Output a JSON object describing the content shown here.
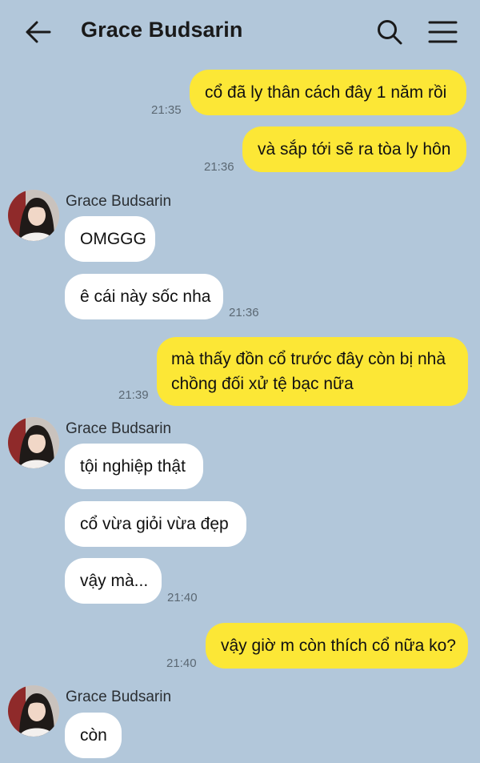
{
  "header": {
    "title": "Grace Budsarin",
    "back_icon": "arrow-left-icon",
    "search_icon": "search-icon",
    "menu_icon": "hamburger-menu-icon"
  },
  "colors": {
    "background": "#b2c7da",
    "outgoing_bubble": "#fce736",
    "incoming_bubble": "#ffffff"
  },
  "messages": [
    {
      "direction": "out",
      "text": "cổ đã ly thân cách đây 1 năm rồi",
      "time": "21:35"
    },
    {
      "direction": "out",
      "text": "và sắp tới sẽ ra tòa ly hôn",
      "time": "21:36"
    },
    {
      "direction": "in",
      "sender": "Grace Budsarin",
      "text": "OMGGG"
    },
    {
      "direction": "in",
      "text": "ê cái này sốc nha",
      "time": "21:36"
    },
    {
      "direction": "out",
      "text": "mà thấy đồn cổ trước đây còn bị nhà chồng đối xử tệ bạc nữa",
      "time": "21:39"
    },
    {
      "direction": "in",
      "sender": "Grace Budsarin",
      "text": "tội nghiệp thật"
    },
    {
      "direction": "in",
      "text": "cổ vừa giỏi vừa đẹp"
    },
    {
      "direction": "in",
      "text": "vậy mà...",
      "time": "21:40"
    },
    {
      "direction": "out",
      "text": "vậy giờ m còn thích cổ nữa ko?",
      "time": "21:40"
    },
    {
      "direction": "in",
      "sender": "Grace Budsarin",
      "text": "còn"
    }
  ]
}
